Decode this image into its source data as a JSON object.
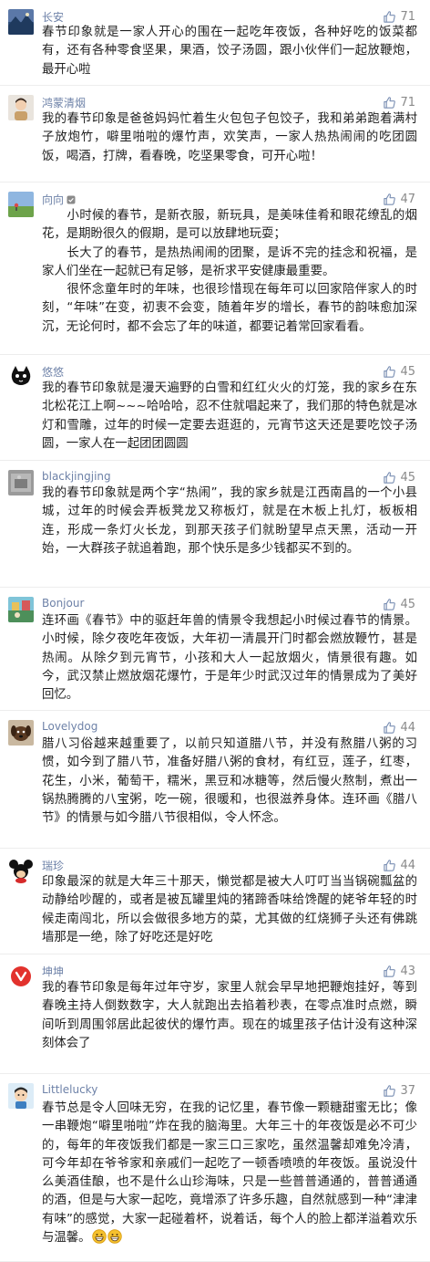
{
  "comments": [
    {
      "user": "长安",
      "avatar": "mountain-landscape-avatar",
      "likes": "71",
      "paragraphs": [
        "春节印象就是一家人开心的围在一起吃年夜饭，各种好吃的饭菜都有，还有各种零食坚果，果酒，饺子汤圆，跟小伙伴们一起放鞭炮，最开心啦"
      ]
    },
    {
      "user": "鸿蒙清烟",
      "avatar": "child-avatar",
      "likes": "71",
      "paragraphs": [
        "我的春节印象是爸爸妈妈忙着生火包包子包饺子，我和弟弟跑着满村子放炮竹，噼里啪啦的爆竹声，欢笑声，一家人热热闹闹的吃团圆饭，喝酒，打牌，看春晚，吃坚果零食，可开心啦！"
      ]
    },
    {
      "user": "向向",
      "avatar": "meadow-avatar",
      "badge": true,
      "likes": "47",
      "paragraphs": [
        "　　小时候的春节，是新衣服，新玩具，是美味佳肴和眼花缭乱的烟花，是期盼很久的假期，是可以放肆地玩耍；",
        "　　长大了的春节，是热热闹闹的团聚，是诉不完的挂念和祝福，是家人们坐在一起就已有足够，是祈求平安健康最重要。",
        "　　很怀念童年时的年味，也很珍惜现在每年可以回家陪伴家人的时刻，“年味”在变，初衷不会变，随着年岁的增长，春节的韵味愈加深沉，无论何时，都不会忘了年的味道，都要记着常回家看看。"
      ]
    },
    {
      "user": "悠悠",
      "avatar": "black-cat-avatar",
      "likes": "45",
      "paragraphs": [
        "我的春节印象就是漫天遍野的白雪和红红火火的灯笼，我的家乡在东北松花江上啊~~~哈哈哈，忍不住就唱起来了，我们那的特色就是冰灯和雪雕，过年的时候一定要去逛逛的，元宵节这天还是要吃饺子汤圆，一家人在一起团团圆圆"
      ]
    },
    {
      "user": "blackjingjing",
      "avatar": "gray-photo-avatar",
      "likes": "45",
      "paragraphs": [
        "我的春节印象就是两个字“热闹”，我的家乡就是江西南昌的一个小县城，过年的时候会弄板凳龙又称板灯，就是在木板上扎灯，板板相连，形成一条灯火长龙，到那天孩子们就盼望早点天黑，活动一开始，一大群孩子就追着跑，那个快乐是多少钱都买不到的。"
      ]
    },
    {
      "user": "Bonjour",
      "avatar": "colorful-illustration-avatar",
      "likes": "45",
      "paragraphs": [
        "连环画《春节》中的驱赶年兽的情景令我想起小时候过春节的情景。小时候，除夕夜吃年夜饭，大年初一清晨开门时都会燃放鞭竹，甚是热闹。从除夕到元宵节，小孩和大人一起放烟火，情景很有趣。如今，武汉禁止燃放烟花爆竹，于是年少时武汉过年的情景成为了美好回忆。"
      ]
    },
    {
      "user": "Lovelydog",
      "avatar": "dog-avatar",
      "likes": "44",
      "paragraphs": [
        "腊八习俗越来越重要了，以前只知道腊八节，并没有熬腊八粥的习惯，如今到了腊八节，准备好腊八粥的食材，有红豆，莲子，红枣，花生，小米，葡萄干，糯米，黑豆和冰糖等，然后慢火熬制，煮出一锅热腾腾的八宝粥，吃一碗，很暖和，也很滋养身体。连环画《腊八节》的情景与如今腊八节很相似，令人怀念。"
      ]
    },
    {
      "user": "瑞珍",
      "avatar": "cartoon-mouse-avatar",
      "likes": "44",
      "paragraphs": [
        "印象最深的就是大年三十那天，懒觉都是被大人叮叮当当锅碗瓢盆的动静给吵醒的，或者是被瓦罐里炖的猪蹄香味给馋醒的姥爷年轻的时候走南闯北，所以会做很多地方的菜，尤其做的红烧狮子头还有佛跳墙那是一绝，除了好吃还是好吃"
      ]
    },
    {
      "user": "坤坤",
      "avatar": "red-logo-avatar",
      "likes": "43",
      "paragraphs": [
        "我的春节印象是每年过年守岁，家里人就会早早地把鞭炮挂好，等到春晚主持人倒数数字，大人就跑出去掐着秒表，在零点准时点燃，瞬间听到周围邻居此起彼伏的爆竹声。现在的城里孩子估计没有这种深刻体会了"
      ]
    },
    {
      "user": "Littlelucky",
      "avatar": "cartoon-boy-avatar",
      "likes": "37",
      "paragraphs": [
        "春节总是令人回味无穷，在我的记忆里，春节像一颗糖甜蜜无比；像一串鞭炮“噼里啪啦”炸在我的脑海里。大年三十的年夜饭是必不可少的，每年的年夜饭我们都是一家三口三家吃，虽然温馨却难免冷清，可今年却在爷爷家和亲戚们一起吃了一顿香喷喷的年夜饭。虽说没什么美酒佳酿，也不是什么山珍海味，只是一些普普通通的，普普通通的酒，但是与大家一起吃，竟增添了许多乐趣，自然就感到一种“津津有味”的感觉，大家一起碰着杯，说着话，每个人的脸上都洋溢着欢乐与温馨。"
      ],
      "trailing_emoji": [
        "grinning-emoji",
        "grinning-emoji"
      ]
    }
  ]
}
